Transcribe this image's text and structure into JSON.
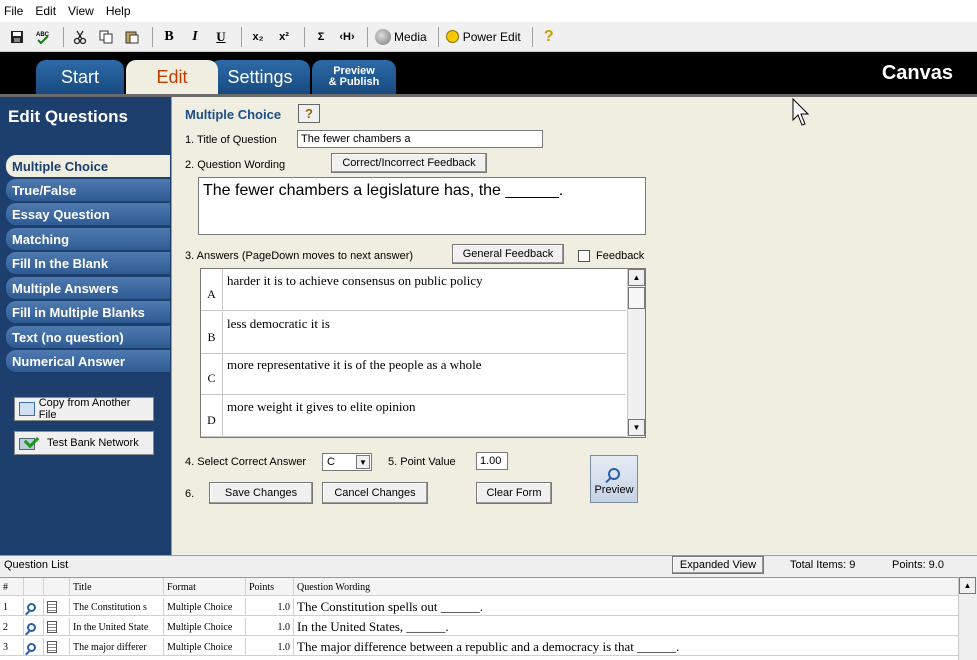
{
  "menu": [
    "File",
    "Edit",
    "View",
    "Help"
  ],
  "toolbar": {
    "bold": "B",
    "italic": "I",
    "underline": "U",
    "subscript": "x₂",
    "superscript": "x²",
    "sigma": "Σ",
    "code": "‹H›",
    "media": "Media",
    "power_edit": "Power Edit",
    "help": "?"
  },
  "tabs": {
    "start": "Start",
    "edit": "Edit",
    "settings": "Settings",
    "preview_line1": "Preview",
    "preview_line2": "& Publish"
  },
  "brand": "Canvas",
  "sidebar": {
    "title": "Edit Questions",
    "items": [
      "Multiple Choice",
      "True/False",
      "Essay Question",
      "Matching",
      "Fill In the Blank",
      "Multiple Answers",
      "Fill in Multiple Blanks",
      "Text (no question)",
      "Numerical Answer"
    ],
    "copy_button": "Copy from Another File",
    "testbank_button": "Test Bank Network"
  },
  "editor": {
    "heading": "Multiple Choice",
    "help": "?",
    "title_label": "1.  Title of Question",
    "title_value": "The fewer chambers a",
    "wording_label": "2.  Question Wording",
    "feedback_button": "Correct/Incorrect Feedback",
    "wording_value": "The fewer chambers a legislature has, the ______.",
    "answers_label": "3.  Answers  (PageDown moves to next answer)",
    "general_feedback_button": "General Feedback",
    "feedback_checkbox_label": "Feedback",
    "answers": [
      {
        "letter": "A",
        "text": "harder it is to achieve consensus on public policy"
      },
      {
        "letter": "B",
        "text": "less democratic it is"
      },
      {
        "letter": "C",
        "text": "more representative it is of the people as a whole"
      },
      {
        "letter": "D",
        "text": "more weight it gives to elite opinion"
      }
    ],
    "correct_label": "4.  Select Correct Answer",
    "correct_value": "C",
    "point_label": "5.  Point Value",
    "point_value": "1.00",
    "step6": "6.",
    "save_button": "Save Changes",
    "cancel_button": "Cancel Changes",
    "clear_button": "Clear Form",
    "preview_button": "Preview"
  },
  "question_list": {
    "label": "Question List",
    "expanded_button": "Expanded View",
    "total_items": "Total Items: 9",
    "points": "Points: 9.0",
    "columns": [
      "#",
      "",
      "",
      "Title",
      "Format",
      "Points",
      "Question Wording"
    ],
    "rows": [
      {
        "num": "1",
        "title": "The Constitution s",
        "format": "Multiple Choice",
        "points": "1.0",
        "wording": "The Constitution spells out ______."
      },
      {
        "num": "2",
        "title": "In the United State",
        "format": "Multiple Choice",
        "points": "1.0",
        "wording": "In the United States, ______."
      },
      {
        "num": "3",
        "title": "The major differer",
        "format": "Multiple Choice",
        "points": "1.0",
        "wording": "The major difference between a republic and a democracy is that ______."
      }
    ]
  }
}
